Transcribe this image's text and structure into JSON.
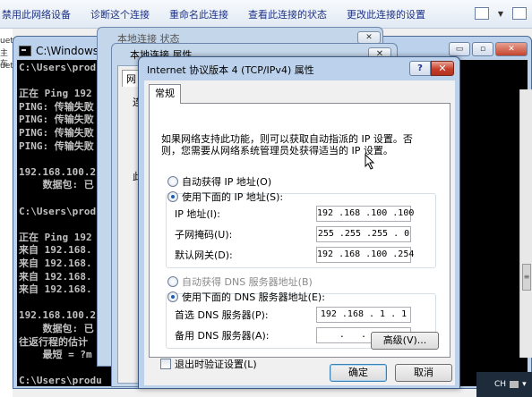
{
  "toolbar": {
    "items": [
      "禁用此网络设备",
      "诊断这个连接",
      "重命名此连接",
      "查看此连接的状态",
      "更改此连接的设置"
    ]
  },
  "left_strip": {
    "lines": [
      "uet",
      "主车",
      "uet"
    ]
  },
  "console": {
    "title": "C:\\Windows\\s",
    "lines": [
      "C:\\Users\\prod",
      "",
      "正在 Ping 192",
      "PING: 传输失败",
      "PING: 传输失败",
      "PING: 传输失败",
      "PING: 传输失败",
      "",
      "192.168.100.2",
      "    数据包: 已",
      "",
      "C:\\Users\\prod",
      "",
      "正在 Ping 192",
      "来自 192.168.",
      "来自 192.168.",
      "来自 192.168.",
      "来自 192.168.",
      "",
      "192.168.100.2",
      "    数据包: 已",
      "往返行程的估计",
      "    最短 = ?m",
      "",
      "C:\\Users\\produ"
    ],
    "controls": [
      "▭",
      "▫",
      "✕"
    ]
  },
  "status_window": {
    "title": "本地连接 状态",
    "close": "✕"
  },
  "local_window": {
    "title": "本地连接 属性",
    "close": "✕",
    "tab": "网",
    "frag1": "连",
    "frag2": "此"
  },
  "dialog": {
    "title": "Internet 协议版本 4 (TCP/IPv4) 属性",
    "help": "?",
    "close": "✕",
    "tab": "常规",
    "description": "如果网络支持此功能，则可以获取自动指派的 IP 设置。否则，您需要从网络系统管理员处获得适当的 IP 设置。",
    "auto_ip_label": "自动获得 IP 地址(O)",
    "manual_ip_label": "使用下面的 IP 地址(S):",
    "ip_label": "IP 地址(I):",
    "ip_value": "192 .168 .100 .100",
    "mask_label": "子网掩码(U):",
    "mask_value": "255 .255 .255 . 0",
    "gateway_label": "默认网关(D):",
    "gateway_value": "192 .168 .100 .254",
    "auto_dns_label": "自动获得 DNS 服务器地址(B)",
    "manual_dns_label": "使用下面的 DNS 服务器地址(E):",
    "preferred_dns_label": "首选 DNS 服务器(P):",
    "preferred_dns_value": "192 .168 . 1 . 1",
    "alternate_dns_label": "备用 DNS 服务器(A):",
    "alternate_dns_value": "  .   .   .  ",
    "validate_label": "退出时验证设置(L)",
    "advanced_button": "高级(V)...",
    "ok_button": "确定",
    "cancel_button": "取消"
  },
  "tray": {
    "lang": "CH",
    "arrow": "▾"
  }
}
